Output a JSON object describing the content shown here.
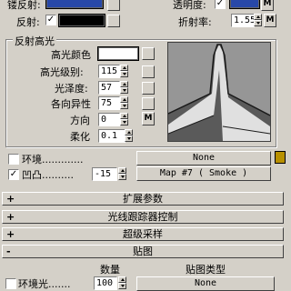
{
  "top": {
    "glossy_reflection_label": "镂反射:",
    "reflection_label": "反射:",
    "transparency_label": "透明度:",
    "refraction_label": "折射率:",
    "refraction_value": "1.55",
    "m_label": "M"
  },
  "specular": {
    "group_title": "反射高光",
    "color_label": "高光颜色",
    "level_label": "高光级别:",
    "level_value": "115",
    "glossiness_label": "光泽度:",
    "glossiness_value": "57",
    "anisotropy_label": "各向异性",
    "anisotropy_value": "75",
    "orientation_label": "方向",
    "orientation_value": "0",
    "soften_label": "柔化",
    "soften_value": "0.1",
    "m_label": "M"
  },
  "maps_top": {
    "environment_label": "环境.............",
    "environment_map": "None",
    "bump_label": "凹凸..........",
    "bump_checked": "✓",
    "bump_amount": "-15",
    "bump_map": "Map #7  ( Smoke )"
  },
  "rollouts": [
    {
      "sign": "+",
      "title": "扩展参数"
    },
    {
      "sign": "+",
      "title": "光线跟踪器控制"
    },
    {
      "sign": "+",
      "title": "超级采样"
    },
    {
      "sign": "-",
      "title": "贴图"
    }
  ],
  "maps_table": {
    "amount_header": "数量",
    "map_type_header": "贴图类型",
    "ambient_label": "环境光.......",
    "ambient_amount": "100",
    "ambient_map": "None"
  },
  "colors": {
    "panel": "#d4d0c8",
    "blue_swatch": "#2848a8",
    "black_swatch": "#000000"
  }
}
